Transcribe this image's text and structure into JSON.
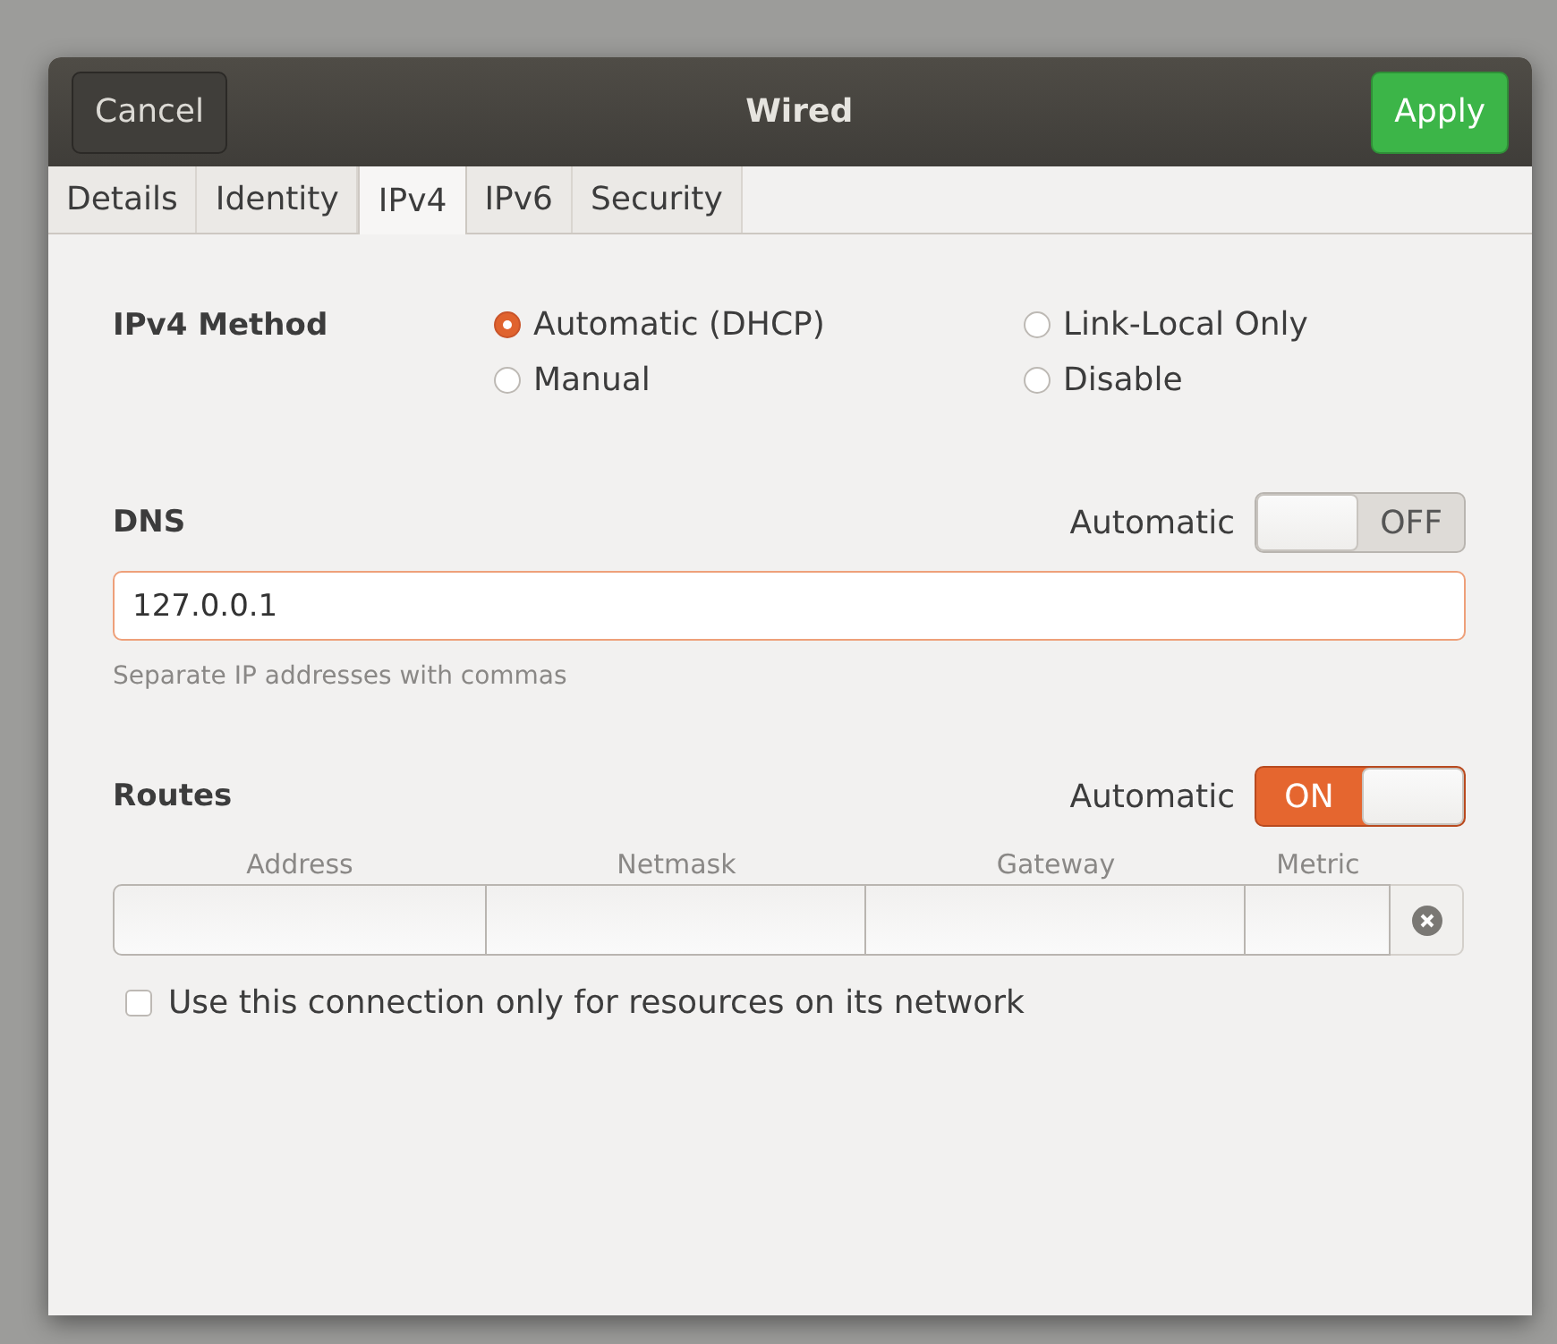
{
  "window": {
    "title": "Wired",
    "cancel": "Cancel",
    "apply": "Apply"
  },
  "tabs": [
    {
      "label": "Details",
      "selected": false
    },
    {
      "label": "Identity",
      "selected": false
    },
    {
      "label": "IPv4",
      "selected": true
    },
    {
      "label": "IPv6",
      "selected": false
    },
    {
      "label": "Security",
      "selected": false
    }
  ],
  "ipv4_method": {
    "label": "IPv4 Method",
    "options": [
      {
        "label": "Automatic (DHCP)",
        "selected": true
      },
      {
        "label": "Link-Local Only",
        "selected": false
      },
      {
        "label": "Manual",
        "selected": false
      },
      {
        "label": "Disable",
        "selected": false
      }
    ]
  },
  "dns": {
    "label": "DNS",
    "automatic_label": "Automatic",
    "automatic": {
      "on": false,
      "text": "OFF"
    },
    "value": "127.0.0.1",
    "hint": "Separate IP addresses with commas"
  },
  "routes": {
    "label": "Routes",
    "automatic_label": "Automatic",
    "automatic": {
      "on": true,
      "text": "ON"
    },
    "columns": [
      "Address",
      "Netmask",
      "Gateway",
      "Metric"
    ]
  },
  "restrict": {
    "label": "Use this connection only for resources on its network",
    "checked": false
  }
}
